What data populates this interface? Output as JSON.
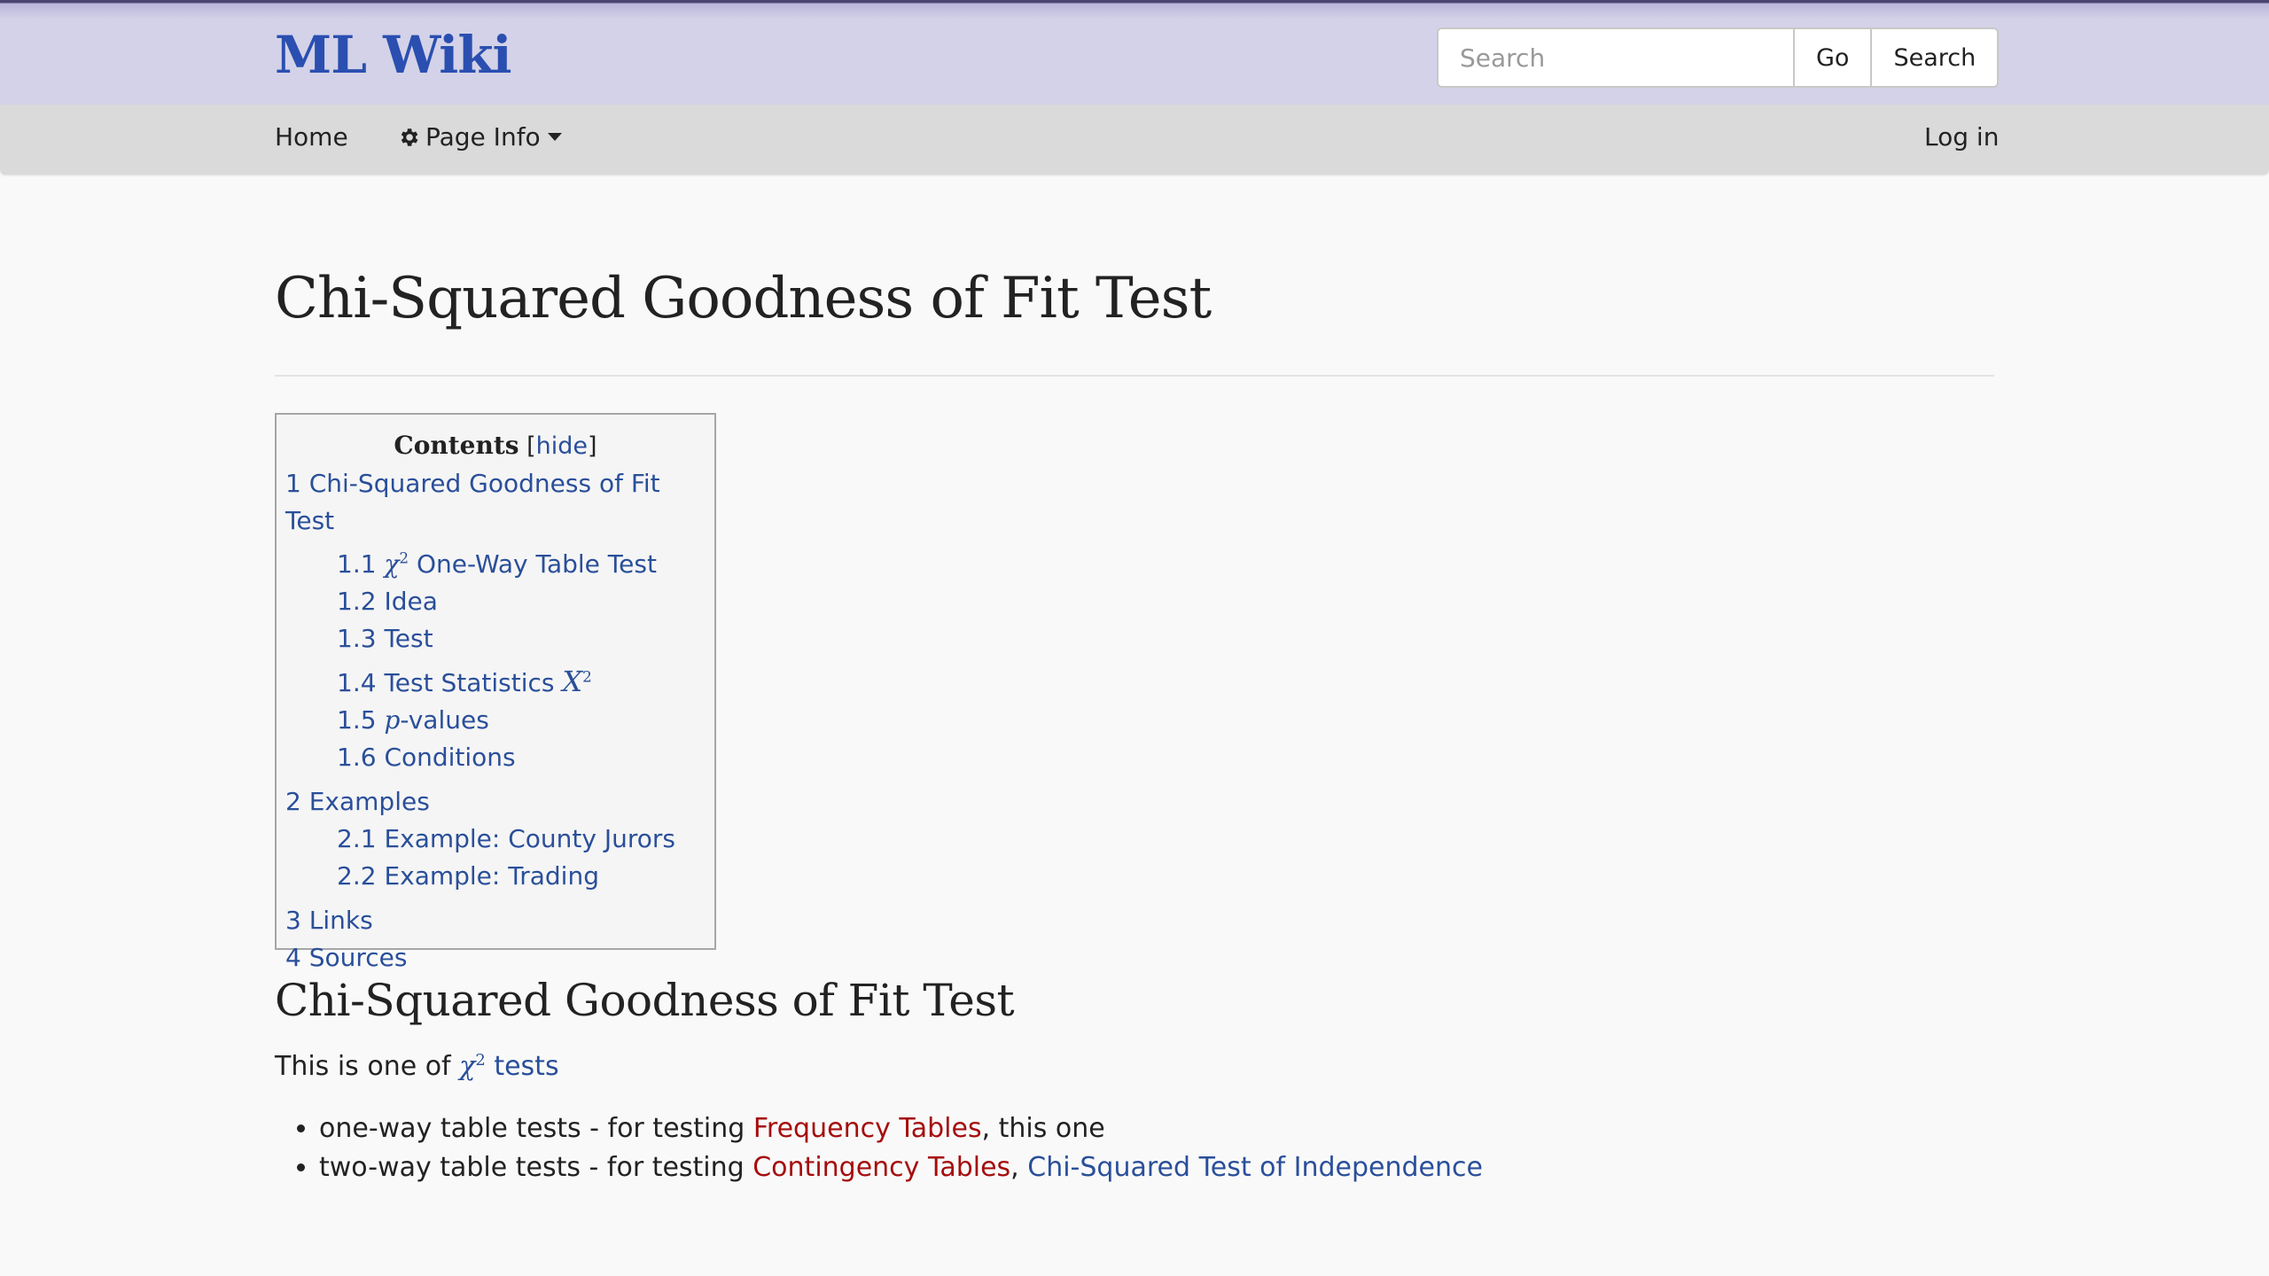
{
  "header": {
    "brand": "ML Wiki",
    "search": {
      "placeholder": "Search",
      "value": "",
      "go_label": "Go",
      "search_label": "Search"
    }
  },
  "nav": {
    "home": "Home",
    "page_info": "Page Info",
    "page_info_icon": "gear-icon",
    "login": "Log in"
  },
  "page": {
    "title": "Chi-Squared Goodness of Fit Test"
  },
  "toc": {
    "title": "Contents",
    "hide_label": "hide",
    "items": [
      {
        "num": "1",
        "text": "Chi-Squared Goodness of Fit Test",
        "level": 1
      },
      {
        "num": "1.1",
        "math": "χ",
        "sup": "2",
        "text": " One-Way Table Test",
        "level": 2
      },
      {
        "num": "1.2",
        "text": "Idea",
        "level": 2
      },
      {
        "num": "1.3",
        "text": "Test",
        "level": 2
      },
      {
        "num": "1.4",
        "text": "Test Statistics ",
        "math_after": "X",
        "sup": "2",
        "level": 2
      },
      {
        "num": "1.5",
        "math": "p",
        "text": "-values",
        "level": 2
      },
      {
        "num": "1.6",
        "text": "Conditions",
        "level": 2
      },
      {
        "num": "2",
        "text": "Examples",
        "level": 1
      },
      {
        "num": "2.1",
        "text": "Example: County Jurors",
        "level": 2
      },
      {
        "num": "2.2",
        "text": "Example: Trading",
        "level": 2
      },
      {
        "num": "3",
        "text": "Links",
        "level": 1
      },
      {
        "num": "4",
        "text": "Sources",
        "level": 1
      }
    ]
  },
  "section": {
    "heading": "Chi-Squared Goodness of Fit Test",
    "intro_prefix": "This is one of ",
    "intro_math": "χ",
    "intro_sup": "2",
    "intro_link": " tests",
    "bullets": [
      {
        "prefix": "one-way table tests - for testing ",
        "link1": "Frequency Tables",
        "link1_status": "missing",
        "suffix": ", this one"
      },
      {
        "prefix": "two-way table tests - for testing ",
        "link1": "Contingency Tables",
        "link1_status": "missing",
        "sep": ", ",
        "link2": "Chi-Squared Test of Independence",
        "link2_status": "existing"
      }
    ]
  },
  "colors": {
    "header_bg": "#d4d2e8",
    "nav_bg": "#dadada",
    "brand": "#2a4fb0",
    "link": "#2a4f9a",
    "missing_link": "#a50d0d"
  }
}
